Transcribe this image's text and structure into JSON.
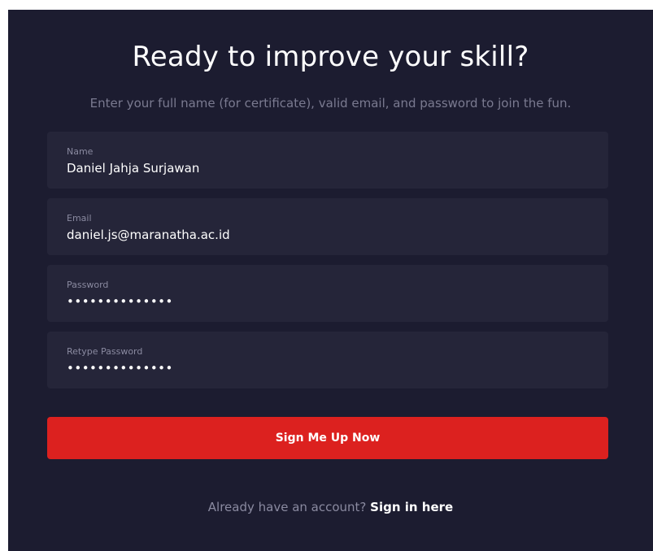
{
  "form": {
    "title": "Ready to improve your skill?",
    "subtitle": "Enter your full name (for certificate), valid email, and password to join the fun.",
    "fields": [
      {
        "label": "Name",
        "value": "Daniel Jahja Surjawan"
      },
      {
        "label": "Email",
        "value": "daniel.js@maranatha.ac.id"
      },
      {
        "label": "Password",
        "value": "••••••••••••••"
      },
      {
        "label": "Retype Password",
        "value": "••••••••••••••"
      }
    ],
    "submit_label": "Sign Me Up Now",
    "signin_prompt": "Already have an account?",
    "signin_link": "Sign in here"
  },
  "colors": {
    "background": "#1c1c30",
    "field_background": "#252539",
    "accent": "#dc211f",
    "muted_text": "#8a8aa0"
  }
}
